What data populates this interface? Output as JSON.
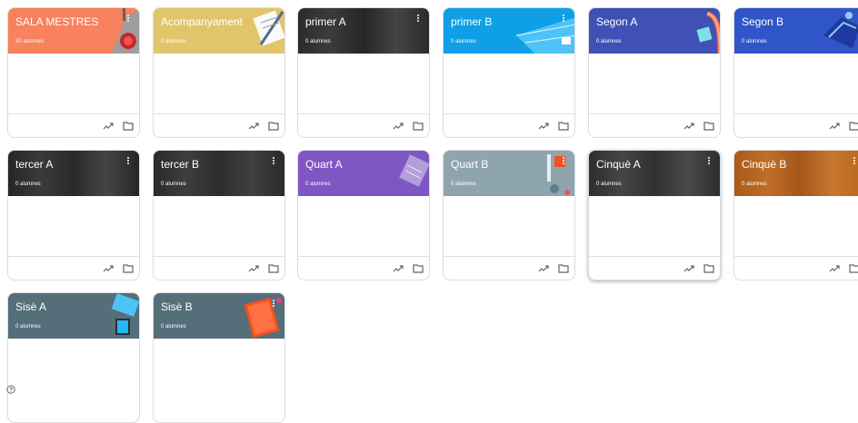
{
  "classes": [
    {
      "title": "SALA MESTRES",
      "students": "30 alumnes",
      "color": "#f8815e",
      "theme": "target-art"
    },
    {
      "title": "Acompanyament",
      "students": "0 alumnes",
      "color": "#e2c56a",
      "theme": "paper-pencil"
    },
    {
      "title": "primer A",
      "students": "0 alumnes",
      "color": "#2b2b2b",
      "theme": "crowd-photo"
    },
    {
      "title": "primer B",
      "students": "0 alumnes",
      "color": "#0f9fe6",
      "theme": "pool"
    },
    {
      "title": "Segon A",
      "students": "0 alumnes",
      "color": "#3f51b5",
      "theme": "swimmer"
    },
    {
      "title": "Segon B",
      "students": "0 alumnes",
      "color": "#2f55c8",
      "theme": "shoes"
    },
    {
      "title": "tercer A",
      "students": "0 alumnes",
      "color": "#262626",
      "theme": "crowd-photo"
    },
    {
      "title": "tercer B",
      "students": "0 alumnes",
      "color": "#2a2a2a",
      "theme": "crowd-photo"
    },
    {
      "title": "Quart A",
      "students": "0 alumnes",
      "color": "#7e57c2",
      "theme": "notebook"
    },
    {
      "title": "Quart B",
      "students": "0 alumnes",
      "color": "#8fa5ad",
      "theme": "lab"
    },
    {
      "title": "Cinquè A",
      "students": "0 alumnes",
      "color": "#2e2e2e",
      "theme": "crowd-photo"
    },
    {
      "title": "Cinquè B",
      "students": "0 alumnes",
      "color": "#b8661e",
      "theme": "crowd-photo-orange"
    },
    {
      "title": "Sisè A",
      "students": "0 alumnes",
      "color": "#546e7a",
      "theme": "devices"
    },
    {
      "title": "Sisè B",
      "students": "0 alumnes",
      "color": "#546e7a",
      "theme": "book"
    }
  ],
  "icons": {
    "trend": "trending-up-icon",
    "folder": "folder-icon",
    "menu": "more-vert-icon",
    "help": "help-icon"
  }
}
